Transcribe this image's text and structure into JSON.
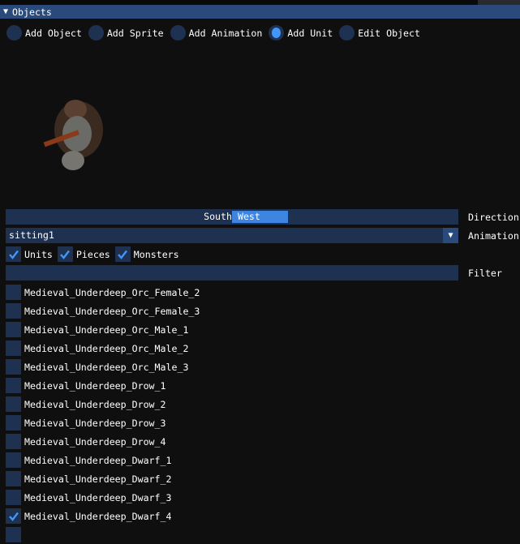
{
  "panel": {
    "title": "Objects"
  },
  "modes": [
    {
      "label": "Add Object",
      "selected": false
    },
    {
      "label": "Add Sprite",
      "selected": false
    },
    {
      "label": "Add Animation",
      "selected": false
    },
    {
      "label": "Add Unit",
      "selected": true
    },
    {
      "label": "Edit Object",
      "selected": false
    }
  ],
  "direction": {
    "value_text": "South West",
    "label": "Direction",
    "index": 4,
    "max_index": 7
  },
  "animation": {
    "value": "sitting1",
    "label": "Animation"
  },
  "filters": [
    {
      "label": "Units",
      "checked": true
    },
    {
      "label": "Pieces",
      "checked": true
    },
    {
      "label": "Monsters",
      "checked": true
    }
  ],
  "filter": {
    "value": "",
    "label": "Filter"
  },
  "units": [
    {
      "name": "Medieval_Underdeep_Orc_Female_2",
      "checked": false
    },
    {
      "name": "Medieval_Underdeep_Orc_Female_3",
      "checked": false
    },
    {
      "name": "Medieval_Underdeep_Orc_Male_1",
      "checked": false
    },
    {
      "name": "Medieval_Underdeep_Orc_Male_2",
      "checked": false
    },
    {
      "name": "Medieval_Underdeep_Orc_Male_3",
      "checked": false
    },
    {
      "name": "Medieval_Underdeep_Drow_1",
      "checked": false
    },
    {
      "name": "Medieval_Underdeep_Drow_2",
      "checked": false
    },
    {
      "name": "Medieval_Underdeep_Drow_3",
      "checked": false
    },
    {
      "name": "Medieval_Underdeep_Drow_4",
      "checked": false
    },
    {
      "name": "Medieval_Underdeep_Dwarf_1",
      "checked": false
    },
    {
      "name": "Medieval_Underdeep_Dwarf_2",
      "checked": false
    },
    {
      "name": "Medieval_Underdeep_Dwarf_3",
      "checked": false
    },
    {
      "name": "Medieval_Underdeep_Dwarf_4",
      "checked": true
    }
  ],
  "colors": {
    "accent": "#4296fa",
    "frame": "#1f3150",
    "header": "#294a7a",
    "bg": "#0f0f0f"
  }
}
